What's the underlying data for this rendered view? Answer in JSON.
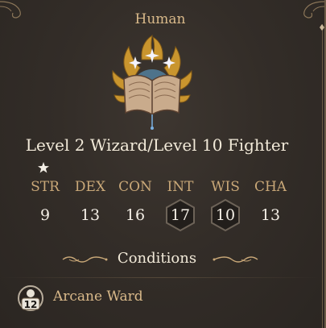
{
  "character": {
    "race": "Human",
    "class_line": "Level 2 Wizard/Level 10 Fighter"
  },
  "abilities": [
    {
      "label": "STR",
      "value": "9",
      "highlighted": false
    },
    {
      "label": "DEX",
      "value": "13",
      "highlighted": false
    },
    {
      "label": "CON",
      "value": "16",
      "highlighted": false
    },
    {
      "label": "INT",
      "value": "17",
      "highlighted": true
    },
    {
      "label": "WIS",
      "value": "10",
      "highlighted": true
    },
    {
      "label": "CHA",
      "value": "13",
      "highlighted": false
    }
  ],
  "conditions": {
    "title": "Conditions",
    "items": [
      {
        "label": "Arcane Ward",
        "badge": "12",
        "icon": "arcane-ward-icon"
      }
    ]
  },
  "colors": {
    "accent": "#d9b98a",
    "ability_label": "#c9a878",
    "text": "#f2ead9"
  }
}
